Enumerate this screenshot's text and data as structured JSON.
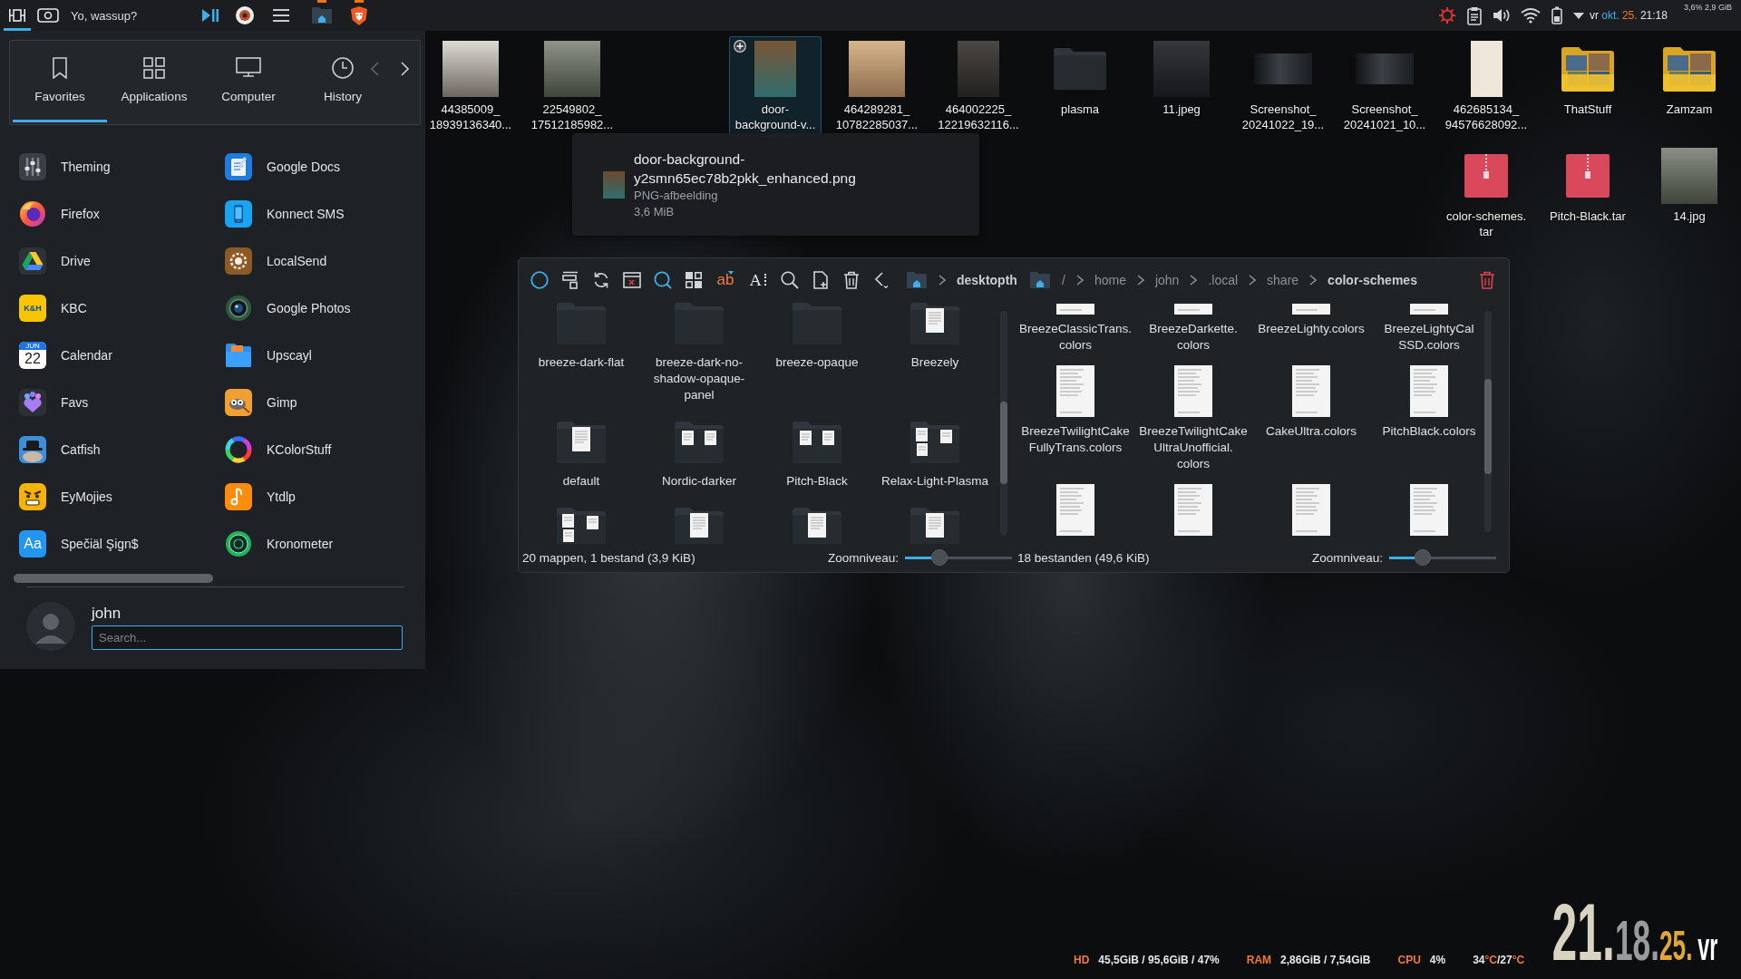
{
  "top_panel": {
    "launcher_button": {
      "active": true
    },
    "greeting": "Yo, wassup?",
    "tasks": [
      {
        "attention": true
      },
      {
        "attention": true
      }
    ],
    "date_parts": [
      {
        "kind": "weekday",
        "text": "vr"
      },
      {
        "kind": "month",
        "text": "okt."
      },
      {
        "kind": "day",
        "text": "25."
      },
      {
        "kind": "time",
        "text": "21:18"
      }
    ],
    "load_reading": "3,6% 2,9 GiB"
  },
  "launcher": {
    "tabs": [
      {
        "label": "Favorites",
        "selected": true
      },
      {
        "label": "Applications",
        "selected": false
      },
      {
        "label": "Computer",
        "selected": false
      },
      {
        "label": "History",
        "selected": false
      }
    ],
    "apps": [
      {
        "name": "Theming"
      },
      {
        "name": "Google Docs"
      },
      {
        "name": "Firefox"
      },
      {
        "name": "Konnect SMS"
      },
      {
        "name": "Drive"
      },
      {
        "name": "LocalSend"
      },
      {
        "name": "KBC",
        "icon_text": [
          "K&H"
        ]
      },
      {
        "name": "Google Photos"
      },
      {
        "name": "Calendar",
        "icon_text": [
          "JUN",
          "22"
        ]
      },
      {
        "name": "Upscayl"
      },
      {
        "name": "Favs"
      },
      {
        "name": "Gimp"
      },
      {
        "name": "Catfish"
      },
      {
        "name": "KColorStuff"
      },
      {
        "name": "EyMojies"
      },
      {
        "name": "Ytdlp"
      },
      {
        "name": "Spečiäl Şign$",
        "icon_text": [
          "Aa"
        ]
      },
      {
        "name": "Kronometer"
      }
    ],
    "user": "john",
    "search": {
      "placeholder": "Search..."
    }
  },
  "desktop_icons": [
    {
      "label": "44385009_\n18939136340...",
      "kind": "photo",
      "selected": false
    },
    {
      "label": "22549802_\n17512185982...",
      "kind": "photo",
      "selected": false
    },
    {
      "label": "door-\nbackground-v...",
      "kind": "portrait-photo",
      "selected": true
    },
    {
      "label": "464289281_\n10782285037...",
      "kind": "photo",
      "selected": false
    },
    {
      "label": "464002225_\n12219632116...",
      "kind": "portrait-photo",
      "selected": false
    },
    {
      "label": "plasma",
      "kind": "folder",
      "selected": false
    },
    {
      "label": "11.jpeg",
      "kind": "photo",
      "selected": false
    },
    {
      "label": "Screenshot_\n20241022_19...",
      "kind": "screenshot",
      "selected": false
    },
    {
      "label": "Screenshot_\n20241021_10...",
      "kind": "screenshot",
      "selected": false
    },
    {
      "label": "462685134_\n94576628092...",
      "kind": "document",
      "selected": false
    },
    {
      "label": "ThatStuff",
      "kind": "photo-folder",
      "selected": false
    },
    {
      "label": "Zamzam",
      "kind": "photo-folder",
      "selected": false
    },
    {
      "label": "color-schemes.\ntar",
      "kind": "archive",
      "selected": false
    },
    {
      "label": "Pitch-Black.tar",
      "kind": "archive",
      "selected": false
    },
    {
      "label": "14.jpg",
      "kind": "photo",
      "selected": false
    }
  ],
  "tooltip": {
    "title": "door-background-\ny2smn65ec78b2pkk_enhanced.png",
    "type": "PNG-afbeelding",
    "size": "3,6 MiB"
  },
  "file_manager": {
    "tool_labels": [
      "ab",
      "A"
    ],
    "panes": [
      {
        "path_truncated": true,
        "path": [
          {
            "text": "desktopth",
            "current": true
          }
        ],
        "items": [
          {
            "name": "breeze-dark-flat",
            "kind": "folder"
          },
          {
            "name": "breeze-dark-no-\nshadow-opaque-\npanel",
            "kind": "folder"
          },
          {
            "name": "breeze-opaque",
            "kind": "folder"
          },
          {
            "name": "Breezely",
            "kind": "folder-one-doc"
          },
          {
            "name": "default",
            "kind": "folder-one-doc"
          },
          {
            "name": "Nordic-darker",
            "kind": "folder-two-docs"
          },
          {
            "name": "Pitch-Black",
            "kind": "folder-two-docs"
          },
          {
            "name": "Relax-Light-Plasma",
            "kind": "folder-three-docs"
          },
          {
            "kind": "folder-three-docs"
          },
          {
            "kind": "folder-one-doc"
          },
          {
            "kind": "folder-one-doc"
          },
          {
            "kind": "folder-one-doc"
          }
        ],
        "status": "20 mappen, 1 bestand (3,9 KiB)",
        "zoom_label": "Zoomniveau:",
        "zoom": {
          "level": 0.29
        }
      },
      {
        "path_truncated": false,
        "path": [
          {
            "text": "/",
            "current": false
          },
          {
            "text": "home",
            "current": false
          },
          {
            "text": "john",
            "current": false
          },
          {
            "text": ".local",
            "current": false
          },
          {
            "text": "share",
            "current": false
          },
          {
            "text": "color-schemes",
            "current": true
          }
        ],
        "items": [
          {
            "name": "BreezeClassicTrans.\ncolors",
            "kind": "colors-file"
          },
          {
            "name": "BreezeDarkette.\ncolors",
            "kind": "colors-file"
          },
          {
            "name": "BreezeLighty.colors",
            "kind": "colors-file"
          },
          {
            "name": "BreezeLightyCal\nSSD.colors",
            "kind": "colors-file"
          },
          {
            "name": "BreezeTwilightCake\nFullyTrans.colors",
            "kind": "colors-file"
          },
          {
            "name": "BreezeTwilightCake\nUltraUnofficial.\ncolors",
            "kind": "colors-file"
          },
          {
            "name": "CakeUltra.colors",
            "kind": "colors-file"
          },
          {
            "name": "PitchBlack.colors",
            "kind": "colors-file"
          },
          {
            "kind": "colors-file"
          },
          {
            "kind": "colors-file"
          },
          {
            "kind": "colors-file"
          },
          {
            "kind": "colors-file"
          }
        ],
        "status": "18 bestanden (49,6 KiB)",
        "zoom_label": "Zoomniveau:",
        "zoom": {
          "level": 0.28
        }
      }
    ]
  },
  "desktop_widgets": {
    "stats": [
      {
        "label": "HD",
        "value": "45,5GiB / 95,6GiB / 47%"
      },
      {
        "label": "RAM",
        "value": "2,86GiB / 7,54GiB"
      },
      {
        "label": "CPU",
        "value": "4%"
      }
    ],
    "temperature": [
      {
        "kind": "value",
        "text": "34"
      },
      {
        "kind": "unit",
        "text": "°C"
      },
      {
        "kind": "value",
        "text": "/"
      },
      {
        "kind": "value",
        "text": "27"
      },
      {
        "kind": "unit",
        "text": "°C"
      }
    ],
    "clock": [
      {
        "kind": "hour",
        "text": "21."
      },
      {
        "kind": "minute",
        "text": "18."
      },
      {
        "kind": "second",
        "text": "25."
      },
      {
        "kind": "weekday",
        "text": "vr"
      }
    ]
  }
}
